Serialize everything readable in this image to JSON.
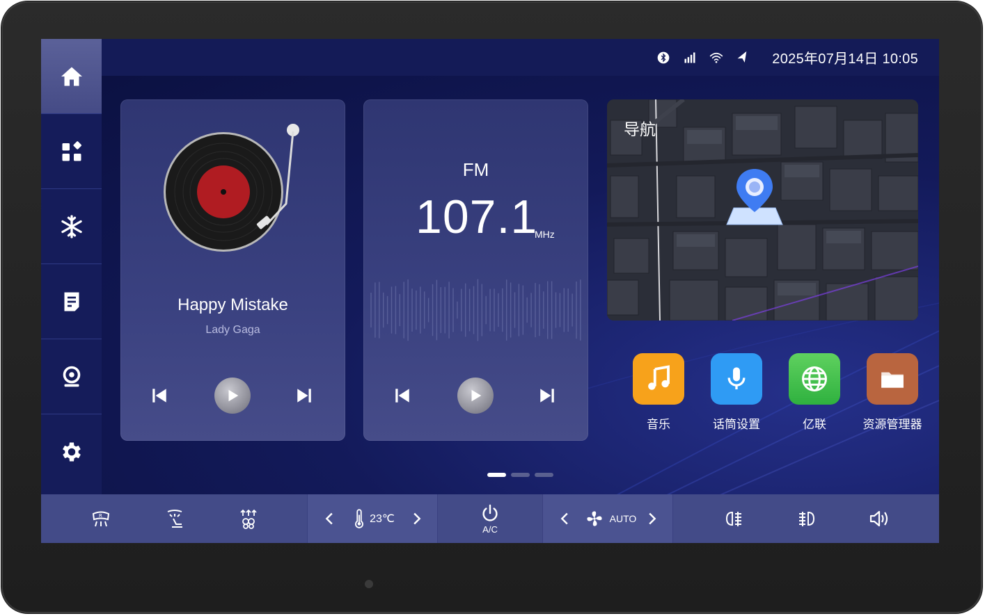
{
  "sidebar": {
    "items": [
      {
        "icon": "home-icon",
        "active": true
      },
      {
        "icon": "apps-icon"
      },
      {
        "icon": "snowflake-icon"
      },
      {
        "icon": "notes-icon"
      },
      {
        "icon": "webcam-icon"
      },
      {
        "icon": "gear-icon"
      }
    ]
  },
  "status": {
    "icons": [
      "bluetooth-icon",
      "cellular-signal-icon",
      "wifi-icon",
      "navigation-arrow-icon"
    ],
    "datetime": "2025年07月14日   10:05"
  },
  "music": {
    "title": "Happy Mistake",
    "artist": "Lady Gaga"
  },
  "radio": {
    "band": "FM",
    "frequency": "107.1",
    "unit": "MHz"
  },
  "navigation": {
    "title": "导航"
  },
  "apps": [
    {
      "label": "音乐",
      "icon": "music-note-icon",
      "color": "#f7a21b"
    },
    {
      "label": "话筒设置",
      "icon": "microphone-icon",
      "color": "#2f9bf4"
    },
    {
      "label": "亿联",
      "icon": "globe-icon",
      "color": "#3dc24a"
    },
    {
      "label": "资源管理器",
      "icon": "folder-icon",
      "color": "#b9653f"
    }
  ],
  "pager": {
    "count": 3,
    "active": 0
  },
  "climate": {
    "temperature": "23℃",
    "ac_label": "A/C",
    "fan_label": "AUTO"
  },
  "colors": {
    "screen_bg": "#0a0f3d",
    "sidebar_bg": "#151c5a",
    "bottombar_bg": "#434b88",
    "accent": "#ffffff"
  }
}
